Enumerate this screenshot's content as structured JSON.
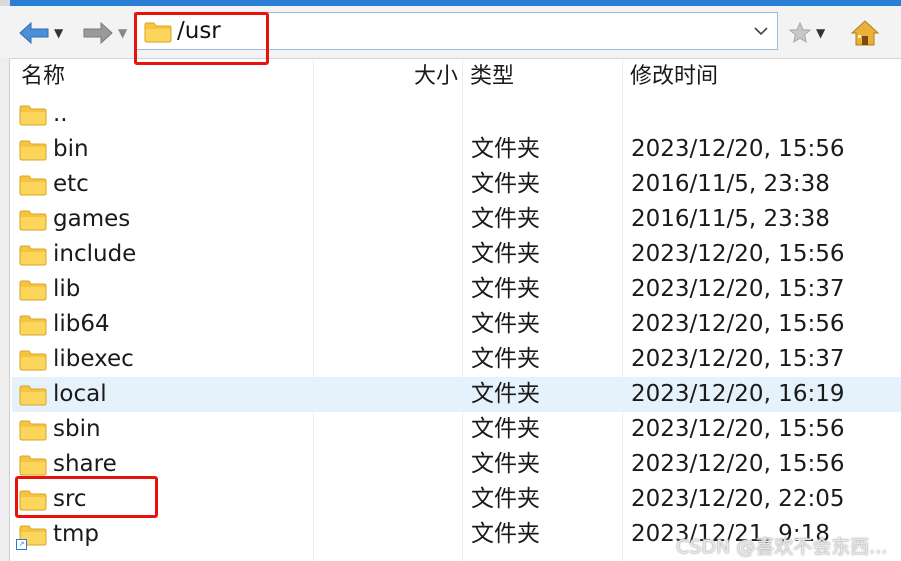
{
  "toolbar": {
    "back_icon": "back-arrow-icon",
    "forward_icon": "forward-arrow-icon",
    "address": "/usr",
    "favorite_icon": "star-icon",
    "home_icon": "home-icon"
  },
  "columns": {
    "name": "名称",
    "size": "大小",
    "type": "类型",
    "modified": "修改时间"
  },
  "rows": [
    {
      "name": "..",
      "type": "",
      "modified": ""
    },
    {
      "name": "bin",
      "type": "文件夹",
      "modified": "2023/12/20, 15:56"
    },
    {
      "name": "etc",
      "type": "文件夹",
      "modified": "2016/11/5, 23:38"
    },
    {
      "name": "games",
      "type": "文件夹",
      "modified": "2016/11/5, 23:38"
    },
    {
      "name": "include",
      "type": "文件夹",
      "modified": "2023/12/20, 15:56"
    },
    {
      "name": "lib",
      "type": "文件夹",
      "modified": "2023/12/20, 15:37"
    },
    {
      "name": "lib64",
      "type": "文件夹",
      "modified": "2023/12/20, 15:56"
    },
    {
      "name": "libexec",
      "type": "文件夹",
      "modified": "2023/12/20, 15:37"
    },
    {
      "name": "local",
      "type": "文件夹",
      "modified": "2023/12/20, 16:19"
    },
    {
      "name": "sbin",
      "type": "文件夹",
      "modified": "2023/12/20, 15:56"
    },
    {
      "name": "share",
      "type": "文件夹",
      "modified": "2023/12/20, 15:56"
    },
    {
      "name": "src",
      "type": "文件夹",
      "modified": "2023/12/20, 22:05"
    },
    {
      "name": "tmp",
      "type": "文件夹",
      "modified": "2023/12/21, 9:18"
    }
  ],
  "selected_row": "local",
  "highlight_color": "#e8120c",
  "watermark": "CSDN @喜欢不会东西..."
}
